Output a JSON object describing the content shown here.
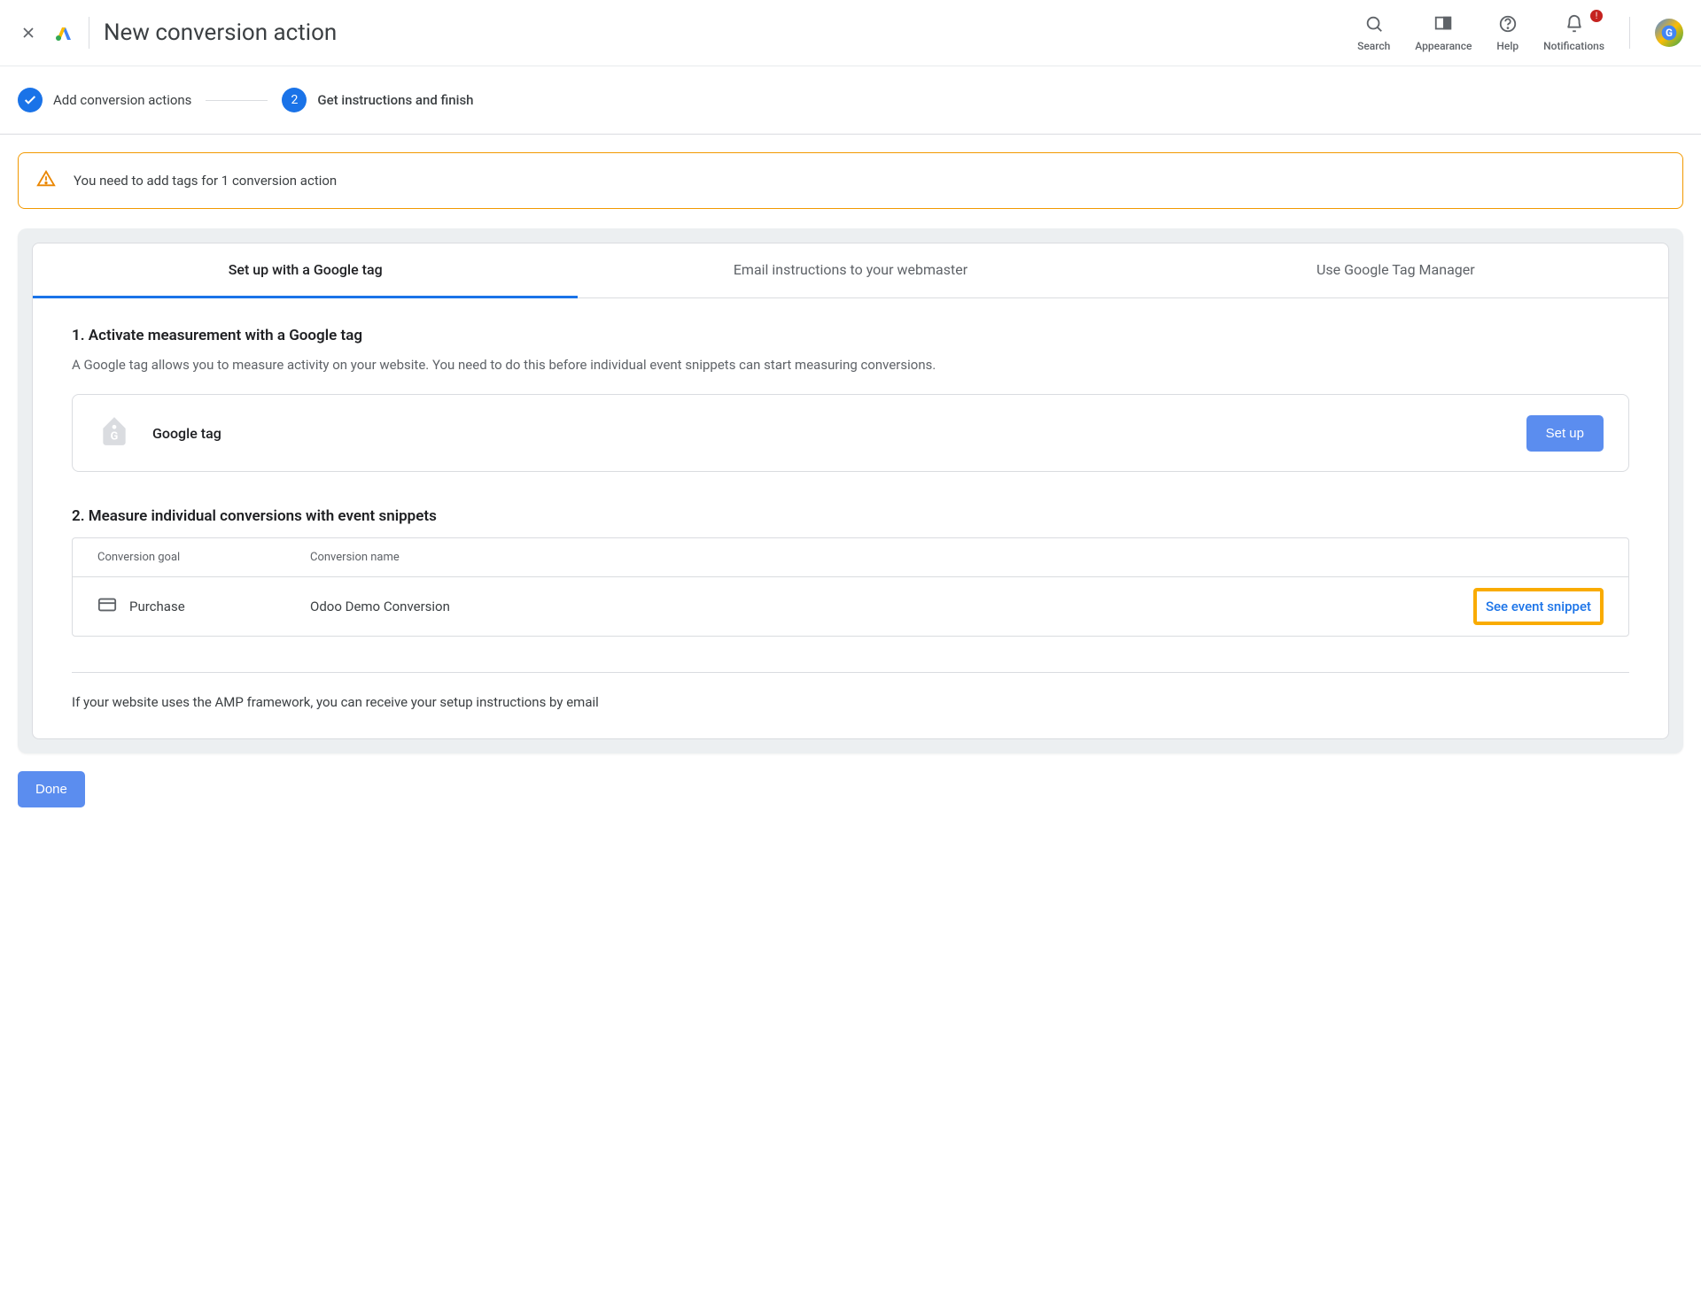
{
  "header": {
    "title": "New conversion action",
    "actions": {
      "search": "Search",
      "appearance": "Appearance",
      "help": "Help",
      "notifications": "Notifications"
    },
    "notif_badge": "!"
  },
  "stepper": {
    "step1_label": "Add conversion actions",
    "step2_number": "2",
    "step2_label": "Get instructions and finish"
  },
  "alert": {
    "text": "You need to add tags for 1 conversion action"
  },
  "tabs": {
    "google_tag": "Set up with a Google tag",
    "email": "Email instructions to your webmaster",
    "gtm": "Use Google Tag Manager"
  },
  "section1": {
    "title": "1. Activate measurement with a Google tag",
    "desc": "A Google tag allows you to measure activity on your website. You need to do this before individual event snippets can start measuring conversions.",
    "gtag_label": "Google tag",
    "setup_btn": "Set up"
  },
  "section2": {
    "title": "2. Measure individual conversions with event snippets",
    "th_goal": "Conversion goal",
    "th_name": "Conversion name",
    "row": {
      "goal": "Purchase",
      "name": "Odoo Demo Conversion",
      "link": "See event snippet"
    }
  },
  "amp_note": "If your website uses the AMP framework, you can receive your setup instructions by email",
  "done_btn": "Done"
}
